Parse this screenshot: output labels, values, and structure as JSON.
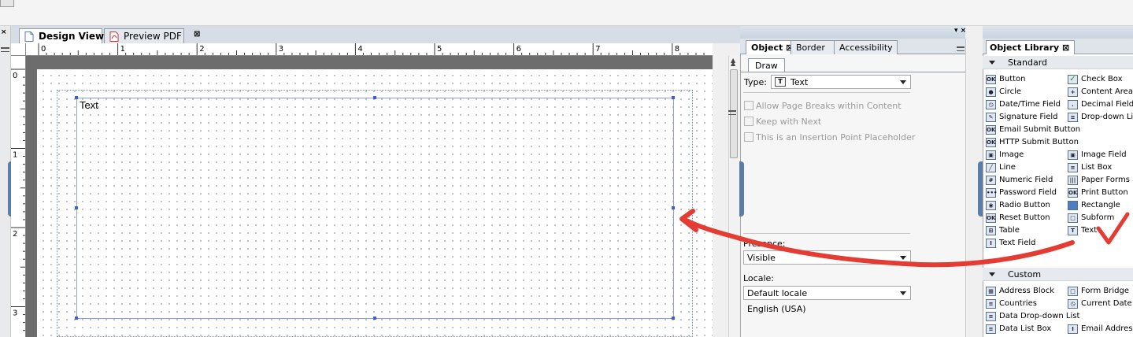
{
  "design_tabs": [
    {
      "label": "Design View",
      "active": true
    },
    {
      "label": "Preview PDF",
      "active": false
    }
  ],
  "ruler": {
    "top_marks": [
      "0",
      "1",
      "2",
      "3",
      "4",
      "5",
      "6",
      "7",
      "8"
    ],
    "left_marks": [
      "0",
      "1",
      "2",
      "3"
    ]
  },
  "canvas": {
    "text_object_label": "Text"
  },
  "object_palette": {
    "tabs": [
      {
        "label": "Object",
        "active": true
      },
      {
        "label": "Border",
        "active": false
      },
      {
        "label": "Accessibility",
        "active": false
      }
    ],
    "subtab": "Draw",
    "type_label": "Type:",
    "type_value": "Text",
    "checkboxes": [
      "Allow Page Breaks within Content",
      "Keep with Next",
      "This is an Insertion Point Placeholder"
    ],
    "presence_label": "Presence:",
    "presence_value": "Visible",
    "locale_label": "Locale:",
    "locale_value": "Default locale",
    "locale_note": "English (USA)"
  },
  "object_library": {
    "title": "Object Library",
    "categories": [
      {
        "name": "Standard",
        "items_left": [
          "Button",
          "Circle",
          "Date/Time Field",
          "Signature Field",
          "Email Submit Button",
          "HTTP Submit Button",
          "Image",
          "Line",
          "Numeric Field",
          "Password Field",
          "Radio Button",
          "Reset Button",
          "Table",
          "Text Field"
        ],
        "items_right": [
          "Check Box",
          "Content Area",
          "Decimal Field",
          "Drop-down List",
          "",
          "",
          "Image Field",
          "List Box",
          "Paper Forms Barcode",
          "Print Button",
          "Rectangle",
          "Subform",
          "Text"
        ]
      },
      {
        "name": "Custom",
        "items_left": [
          "Address Block",
          "Countries",
          "Data Drop-down List",
          "Data List Box"
        ],
        "items_right": [
          "Form Bridge",
          "Current Date",
          "",
          "Email Address"
        ]
      }
    ]
  },
  "colors": {
    "annotation_red": "#e43c33",
    "panel_accent": "#5a7ea8",
    "selection_blue": "#3b62c7"
  }
}
